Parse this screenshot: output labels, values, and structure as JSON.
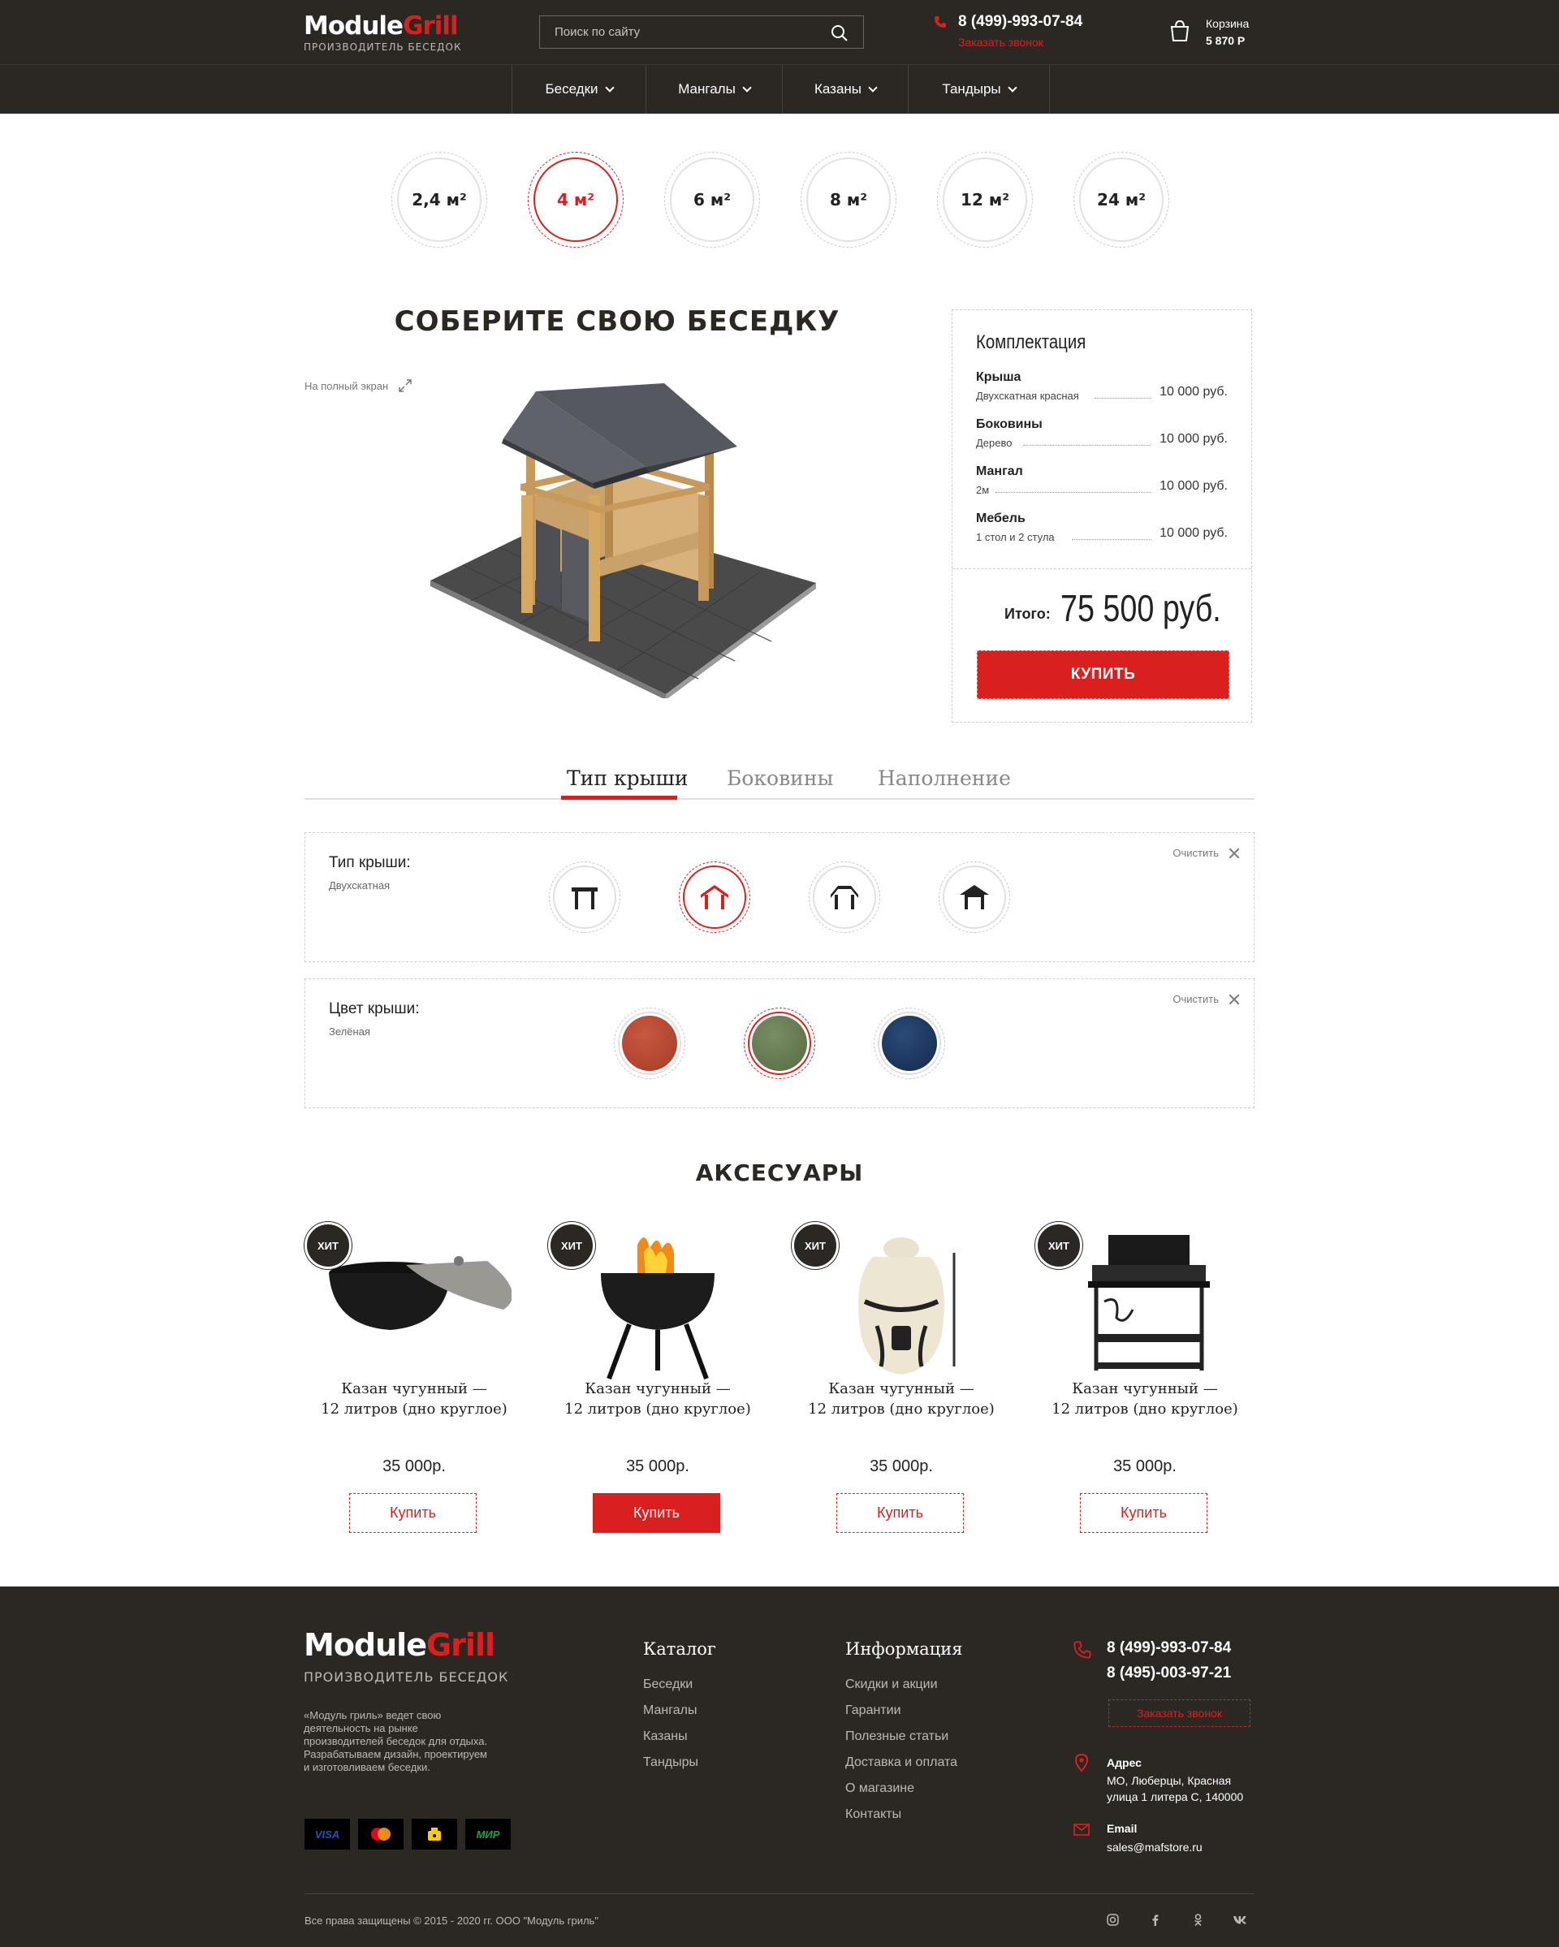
{
  "header": {
    "logo_word1": "Module",
    "logo_word2": "Grill",
    "logo_sub": "ПРОИЗВОДИТЕЛЬ БЕСЕДОК",
    "search_placeholder": "Поиск по сайту",
    "phone": "8 (499)-993-07-84",
    "callback": "Заказать звонок",
    "cart_label": "Корзина",
    "cart_sum": "5 870 Р"
  },
  "nav": {
    "items": [
      {
        "label": "Беседки"
      },
      {
        "label": "Мангалы"
      },
      {
        "label": "Казаны"
      },
      {
        "label": "Тандыры"
      }
    ]
  },
  "sizes": [
    {
      "label": "2,4 м²",
      "active": false
    },
    {
      "label": "4 м²",
      "active": true
    },
    {
      "label": "6 м²",
      "active": false
    },
    {
      "label": "8 м²",
      "active": false
    },
    {
      "label": "12 м²",
      "active": false
    },
    {
      "label": "24 м²",
      "active": false
    }
  ],
  "builder": {
    "title": "СОБЕРИТЕ СВОЮ БЕСЕДКУ",
    "fullscreen": "На полный экран"
  },
  "kit": {
    "title": "Комплектация",
    "rows": [
      {
        "name": "Крыша",
        "sub": "Двухскатная красная",
        "price": "10 000 руб."
      },
      {
        "name": "Боковины",
        "sub": "Дерево",
        "price": "10 000 руб."
      },
      {
        "name": "Мангал",
        "sub": "2м",
        "price": "10 000 руб."
      },
      {
        "name": "Мебель",
        "sub": "1 стол и 2 стула",
        "price": "10 000 руб."
      }
    ],
    "total_label": "Итого:",
    "total_value": "75 500 руб.",
    "buy": "КУПИТЬ"
  },
  "tabs": [
    {
      "label": "Тип крыши",
      "active": true
    },
    {
      "label": "Боковины",
      "active": false
    },
    {
      "label": "Наполнение",
      "active": false
    }
  ],
  "roof_type": {
    "label": "Тип крыши:",
    "value": "Двухскатная",
    "clear": "Очистить",
    "options": [
      "flat-roof-icon",
      "gable-roof-icon",
      "hip-roof-icon",
      "pagoda-roof-icon"
    ],
    "active_index": 1
  },
  "roof_color": {
    "label": "Цвет крыши:",
    "value": "Зелёная",
    "clear": "Очистить",
    "colors": [
      "#b5452f",
      "#6a7d55",
      "#1d3a62"
    ],
    "active_index": 1
  },
  "accessories": {
    "title": "АКСЕСУАРЫ",
    "badge": "ХИТ",
    "items": [
      {
        "name_line1": "Казан чугунный —",
        "name_line2": "12 литров (дно круглое)",
        "price": "35 000р.",
        "buy": "Купить",
        "icon": "cauldron-icon"
      },
      {
        "name_line1": "Казан чугунный —",
        "name_line2": "12 литров (дно круглое)",
        "price": "35 000р.",
        "buy": "Купить",
        "icon": "kettle-grill-icon"
      },
      {
        "name_line1": "Казан чугунный —",
        "name_line2": "12 литров (дно круглое)",
        "price": "35 000р.",
        "buy": "Купить",
        "icon": "tandoor-icon"
      },
      {
        "name_line1": "Казан чугунный —",
        "name_line2": "12 литров (дно круглое)",
        "price": "35 000р.",
        "buy": "Купить",
        "icon": "bbq-station-icon"
      }
    ]
  },
  "footer": {
    "logo_word1": "Module",
    "logo_word2": "Grill",
    "logo_sub": "ПРОИЗВОДИТЕЛЬ БЕСЕДОК",
    "about": [
      "«Модуль гриль» ведет свою",
      "деятельность на  рынке",
      "производителей беседок для отдыха.",
      "Разрабатываем дизайн, проектируем",
      "и изготовливаем беседки."
    ],
    "payments": [
      "VISA",
      "",
      "",
      "МИР"
    ],
    "catalog_title": "Каталог",
    "catalog": [
      "Беседки",
      "Мангалы",
      "Казаны",
      "Тандыры"
    ],
    "info_title": "Информация",
    "info": [
      "Скидки и акции",
      "Гарантии",
      "Полезные статьи",
      "Доставка и оплата",
      "О магазине",
      "Контакты"
    ],
    "phone1": "8 (499)-993-07-84",
    "phone2": "8 (495)-003-97-21",
    "callback": "Заказать звонок",
    "address_label": "Адрес",
    "address": [
      "МО, Люберцы, Красная",
      "улица 1 литера С, 140000"
    ],
    "email_label": "Email",
    "email": "sales@mafstore.ru",
    "copyright": "Все права защищены © 2015 - 2020 гг. ООО \"Модуль гриль\"",
    "social": [
      "instagram-icon",
      "facebook-icon",
      "odnoklassniki-icon",
      "vk-icon"
    ]
  },
  "colors": {
    "accent": "#d9201f",
    "dark": "#2b2824"
  }
}
